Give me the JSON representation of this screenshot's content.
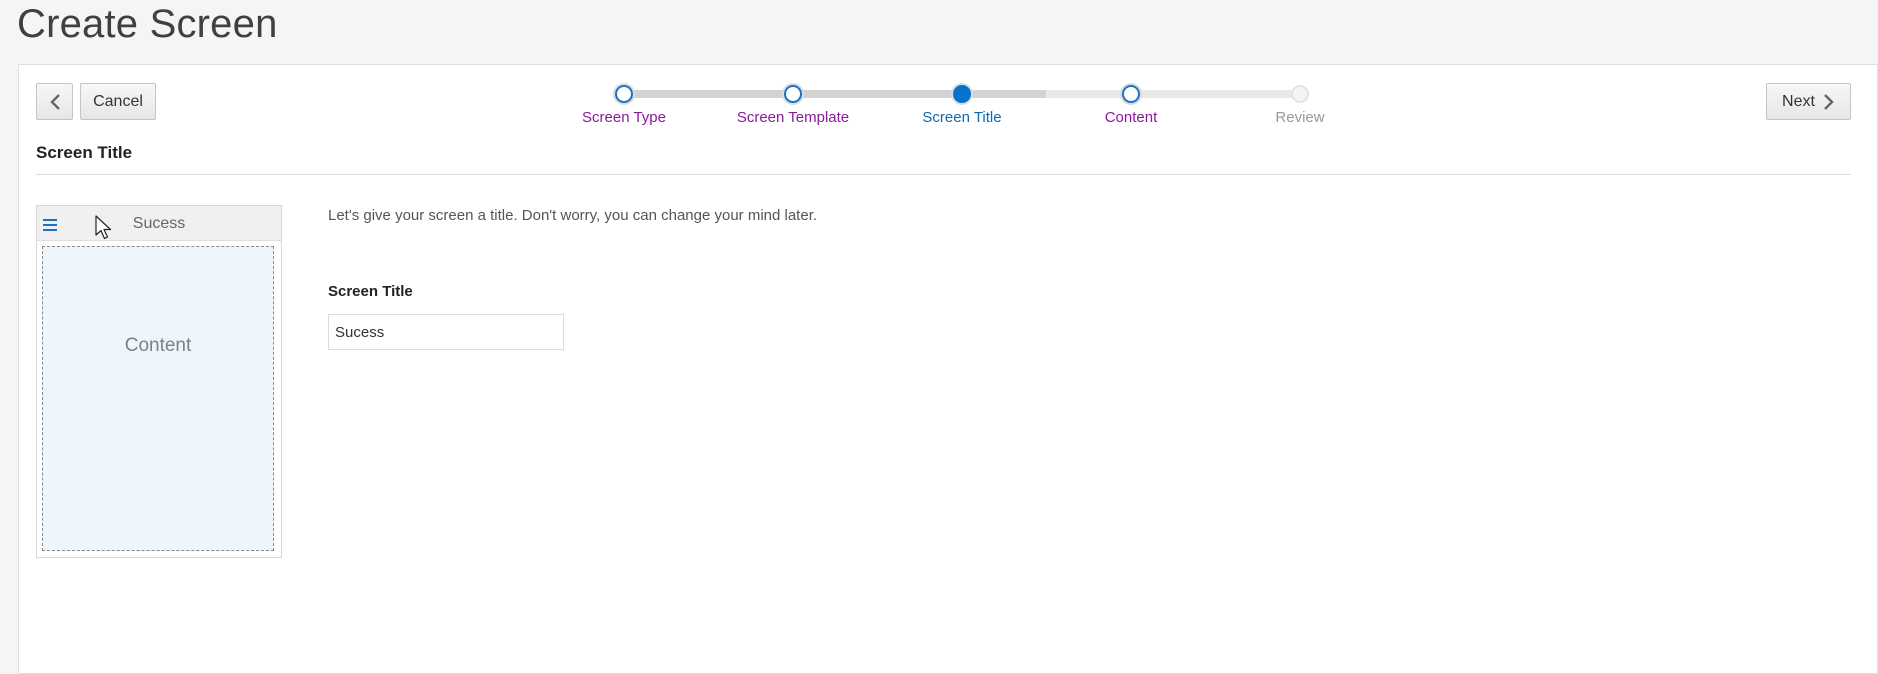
{
  "page": {
    "title": "Create Screen"
  },
  "toolbar": {
    "back_icon": "chevron-left-icon",
    "cancel_label": "Cancel",
    "next_label": "Next",
    "next_icon": "chevron-right-icon"
  },
  "train": {
    "stops": [
      {
        "label": "Screen Type",
        "state": "visited"
      },
      {
        "label": "Screen Template",
        "state": "visited"
      },
      {
        "label": "Screen Title",
        "state": "current"
      },
      {
        "label": "Content",
        "state": "visited"
      },
      {
        "label": "Review",
        "state": "disabled"
      }
    ]
  },
  "section": {
    "title": "Screen Title"
  },
  "preview": {
    "menu_icon": "hamburger-menu-icon",
    "title": "Sucess",
    "content_label": "Content"
  },
  "form": {
    "intro": "Let's give your screen a title. Don't worry, you can change your mind later.",
    "field_label": "Screen Title",
    "field_value": "Sucess"
  },
  "colors": {
    "accent_blue": "#0572ce",
    "visited_purple": "#8a1a9b",
    "disabled_gray": "#9a9a9a",
    "preview_content_bg": "#eef6fd"
  }
}
